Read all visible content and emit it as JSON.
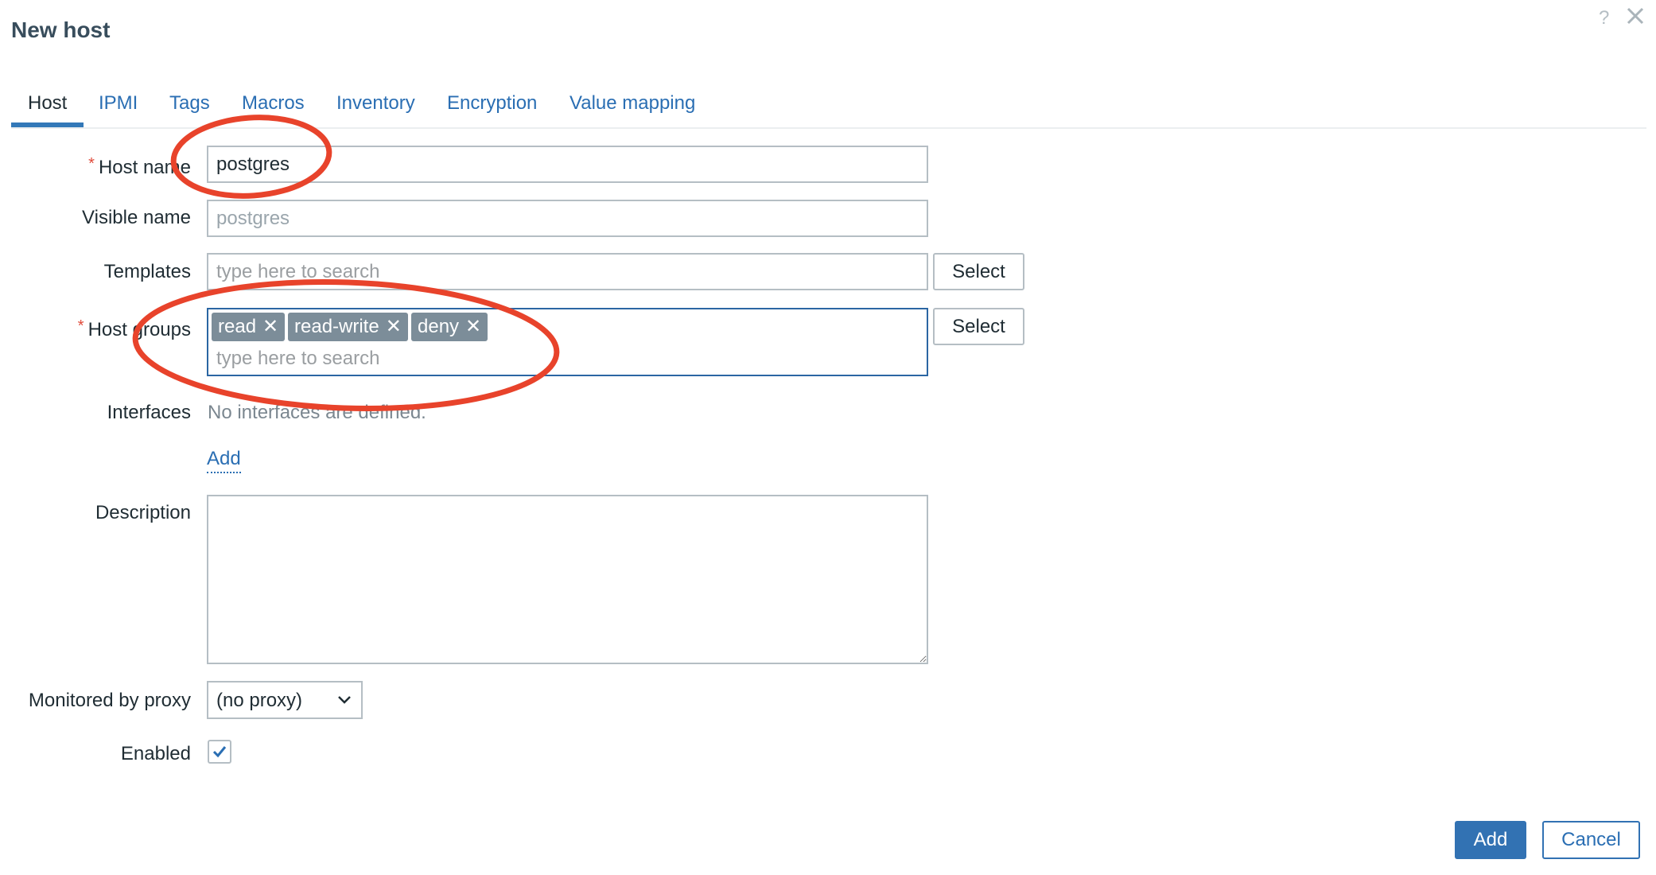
{
  "dialog": {
    "title": "New host",
    "help_icon": "?",
    "close_icon": "close-icon"
  },
  "tabs": [
    {
      "label": "Host",
      "active": true
    },
    {
      "label": "IPMI",
      "active": false
    },
    {
      "label": "Tags",
      "active": false
    },
    {
      "label": "Macros",
      "active": false
    },
    {
      "label": "Inventory",
      "active": false
    },
    {
      "label": "Encryption",
      "active": false
    },
    {
      "label": "Value mapping",
      "active": false
    }
  ],
  "form": {
    "host_name": {
      "label": "Host name",
      "required_mark": "*",
      "value": "postgres"
    },
    "visible_name": {
      "label": "Visible name",
      "value": "",
      "placeholder": "postgres"
    },
    "templates": {
      "label": "Templates",
      "placeholder": "type here to search",
      "select_label": "Select"
    },
    "host_groups": {
      "label": "Host groups",
      "required_mark": "*",
      "chips": [
        "read",
        "read-write",
        "deny"
      ],
      "chip_remove_glyph": "✕",
      "placeholder": "type here to search",
      "select_label": "Select"
    },
    "interfaces": {
      "label": "Interfaces",
      "empty_text": "No interfaces are defined.",
      "add_link": "Add"
    },
    "description": {
      "label": "Description",
      "value": ""
    },
    "proxy": {
      "label": "Monitored by proxy",
      "selected": "(no proxy)"
    },
    "enabled": {
      "label": "Enabled",
      "checked": true
    }
  },
  "footer": {
    "add_label": "Add",
    "cancel_label": "Cancel"
  },
  "colors": {
    "accent": "#3272b3",
    "link": "#2a6eb3",
    "chip": "#7c8d99",
    "required": "#e04a3a",
    "annotation": "#e8432b"
  }
}
